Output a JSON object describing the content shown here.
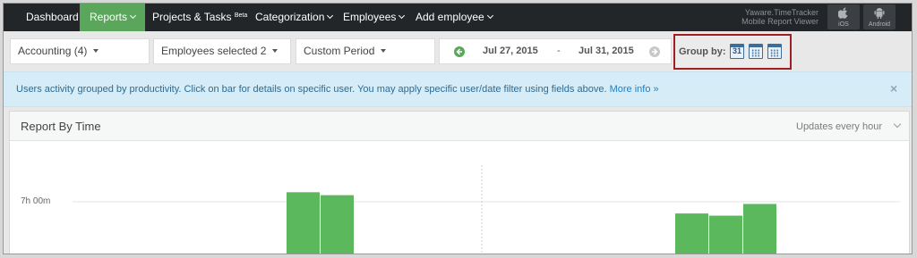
{
  "nav": {
    "items": [
      {
        "label": "Dashboard",
        "dropdown": false
      },
      {
        "label": "Reports",
        "dropdown": true,
        "active": true
      },
      {
        "label": "Projects & Tasks",
        "sup": "Beta",
        "dropdown": false
      },
      {
        "label": "Categorization",
        "dropdown": true
      },
      {
        "label": "Employees",
        "dropdown": true
      },
      {
        "label": "Add employee",
        "dropdown": true
      }
    ],
    "viewer_line1": "Yaware.TimeTracker",
    "viewer_line2": "Mobile Report Viewer",
    "ios_label": "iOS",
    "android_label": "Android"
  },
  "filters": {
    "department": "Accounting (4)",
    "employees": "Employees selected 2",
    "period": "Custom Period",
    "date_from": "Jul 27, 2015",
    "date_sep": "-",
    "date_to": "Jul 31, 2015"
  },
  "groupby": {
    "label": "Group by:",
    "day_number": "31",
    "icons": [
      "calendar-day-icon",
      "calendar-week-icon",
      "calendar-month-icon"
    ]
  },
  "info": {
    "text": "Users activity grouped by productivity. Click on bar for details on specific user. You may apply specific user/date filter using fields above.",
    "link": "More info »",
    "close": "×"
  },
  "panel": {
    "title": "Report By Time",
    "update_note": "Updates every hour"
  },
  "colors": {
    "nav_bg": "#222629",
    "accent_green": "#5aa65a",
    "bar_green": "#5cb85c",
    "info_bg": "#d6ecf7",
    "groupby_border": "#a01f24"
  },
  "chart_data": {
    "type": "bar",
    "ytick_labels": [
      "7h 00m"
    ],
    "groups": [
      {
        "group": 1,
        "values_minutes": [
          446,
          438
        ]
      },
      {
        "group": 2,
        "values_minutes": [
          388,
          382,
          414
        ]
      }
    ],
    "grid": true
  }
}
